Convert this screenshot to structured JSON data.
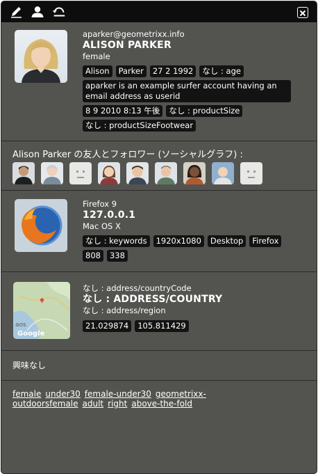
{
  "toolbar": {
    "icons": [
      "pencil-icon",
      "user-icon",
      "reset-icon"
    ],
    "close_icon": "close-icon"
  },
  "profile": {
    "email": "aparker@geometrixx.info",
    "name": "ALISON PARKER",
    "gender": "female",
    "tags": [
      "Alison",
      "Parker",
      "27 2 1992",
      "なし : age"
    ],
    "description": "aparker is an example surfer account having an email address as userid",
    "tags2": [
      "8 9 2010 8:13 午後",
      "なし : productSize"
    ],
    "tags3": [
      "なし : productSizeFootwear"
    ]
  },
  "friends": {
    "title": "Alison Parker の友人とフォロワー (ソーシャルグラフ) :",
    "count": 9
  },
  "device": {
    "browser": "Firefox 9",
    "ip": "127.0.0.1",
    "os": "Mac OS X",
    "tags": [
      "なし : keywords",
      "1920x1080",
      "Desktop",
      "Firefox",
      "808",
      "338"
    ]
  },
  "location": {
    "country_code": "なし : address/countryCode",
    "country": "なし : ADDRESS/COUNTRY",
    "region": "なし : address/region",
    "coords": [
      "21.029874",
      "105.811429"
    ],
    "map_label": "Google"
  },
  "interests": {
    "text": "興味なし"
  },
  "segments": [
    "female",
    "under30",
    "female-under30",
    "geometrixx-outdoors",
    "female",
    "adult",
    "right",
    "above-the-fold"
  ],
  "colors": {
    "panel": "#53544f",
    "toolbar": "#0d0d0d",
    "tag": "#131313"
  }
}
